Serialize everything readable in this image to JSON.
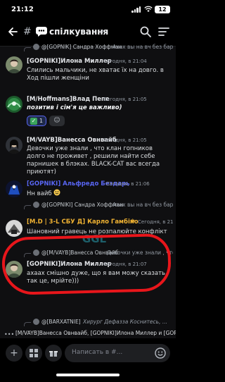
{
  "status": {
    "time": "21:12",
    "battery": "12"
  },
  "header": {
    "channel_prefix": "#",
    "channel_name": "спілкування",
    "chevron": "›"
  },
  "messages": [
    {
      "reply_name": "@[GOPNIK] Сандра Хоффман",
      "reply_text": "Ахах  вы на вч без бархатных никуда 😉 впрочем как и везде. Не интересн...",
      "name": "[GOPNIKI]Илона Миллер",
      "name_color": "#e5e7eb",
      "stamp": "Сегодня, в 21:04",
      "text": "Слились мальчики, не хватає їх на довго. в Ход пішли женщіни"
    },
    {
      "name": "[M/Hoffmans]Влад Пепе",
      "name_color": "#e5e7eb",
      "stamp": "Сегодня, в 21:05",
      "text": "позитив і сім'я це важливо)",
      "reaction_count": "1"
    },
    {
      "name": "[M/VAYB]Ванесса Овнвайб",
      "name_color": "#e5e7eb",
      "stamp": "Сегодня, в 21:05",
      "text": "Девочки уже знали , что клан гопников долго не проживет , решили найти себе парнишек в блэках. BLACK-CAT вас всегда приютят)"
    },
    {
      "name": "[GOPNIKI] Альфредо Бездарь",
      "name_color": "#5865f2",
      "stamp": "Сегодня, в 21:06",
      "text": "Нн вайб"
    },
    {
      "reply_name": "@[GOPNIKI] Сандра Хоффман",
      "reply_text": "Ахах  вы на вч без бархатных никуда 😉 впрочем как и везде. Не интересн...",
      "name": "[M.D | 3-L СБУ Д] Карло Гамбіно",
      "name_color": "#f0b232",
      "stamp": "Сегодня, в 21:06",
      "text": "Шановний гравець не розпалюйте конфлікт"
    },
    {
      "reply_name": "@[M/VAYB]Ванесса Овнвайб",
      "reply_text": "Девочки уже знали , что клан гопников долго...",
      "name": "[GOPNIKI]Илона Миллер",
      "name_color": "#e5e7eb",
      "stamp": "Сегодня, в 21:07",
      "text": "ахаах смішно дуже, що я вам можу сказать так це, мрійте)))"
    },
    {
      "reply_name": "@[BARXATNIE]",
      "reply_text": "Хирург Дефазза Коснитесь, ..."
    }
  ],
  "typing": "[M/VAYB]Ванесса Овнвайб, [GOPNIKI]Илона Миллер и [GOPNIKI] Альфредо",
  "composer": {
    "placeholder": "Написать в #..."
  },
  "watermark": "GGL",
  "colors": {
    "accent": "#5865f2",
    "highlight": "#e8161b",
    "mod_name": "#f0b232"
  }
}
